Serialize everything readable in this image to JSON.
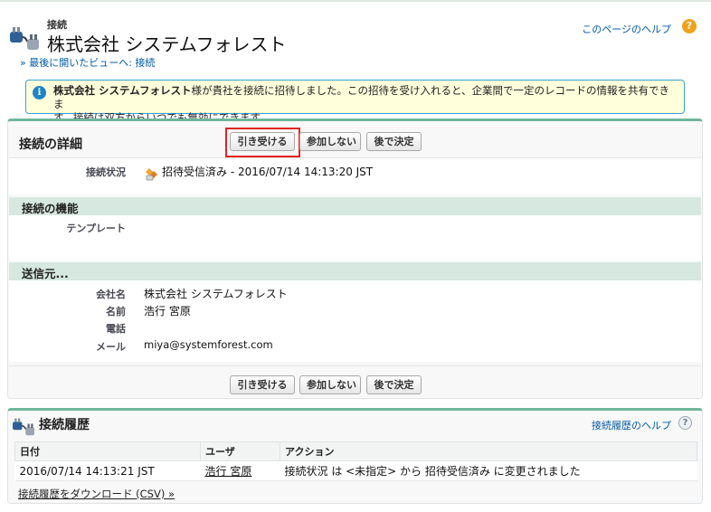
{
  "header": {
    "object_type": "接続",
    "title": "株式会社 システムフォレスト",
    "back_link": "» 最後に開いたビューへ: 接続",
    "help_link": "このページのヘルプ",
    "help_icon": "?"
  },
  "info": {
    "company_bold": "株式会社 システムフォレスト",
    "message_line1_rest": "様が貴社を接続に招待しました。この招待を受け入れると、企業間で一定のレコードの情報を共有できま",
    "message_line2": "す。接続は双方からいつでも無効にできます。",
    "icon": "info-icon"
  },
  "detail": {
    "title": "接続の詳細",
    "buttons": {
      "accept": "引き受ける",
      "decline": "参加しない",
      "later": "後で決定"
    },
    "status_label": "接続状況",
    "status_value": "招待受信済み - 2016/07/14 14:13:20 JST",
    "sections": {
      "features": "接続の機能",
      "sender": "送信元..."
    },
    "template_label": "テンプレート",
    "sender_fields": {
      "company_label": "会社名",
      "company_value": "株式会社 システムフォレスト",
      "name_label": "名前",
      "name_value": "浩行 宮原",
      "phone_label": "電話",
      "phone_value": "",
      "email_label": "メール",
      "email_value": "miya@systemforest.com"
    }
  },
  "history": {
    "title": "接続履歴",
    "help_link": "接続履歴のヘルプ",
    "help_icon": "?",
    "columns": [
      "日付",
      "ユーザ",
      "アクション"
    ],
    "rows": [
      {
        "date": "2016/07/14 14:13:21 JST",
        "user": "浩行 宮原",
        "action": "接続状況 は <未指定> から 招待受信済み に変更されました"
      }
    ],
    "download_link": "接続履歴をダウンロード (CSV) »"
  },
  "colors": {
    "accent_green": "#6fb69a",
    "section_bg": "#d6e8e0",
    "link_blue": "#015ba7",
    "highlight_red": "#e32323",
    "info_bg": "#ffffdc"
  }
}
